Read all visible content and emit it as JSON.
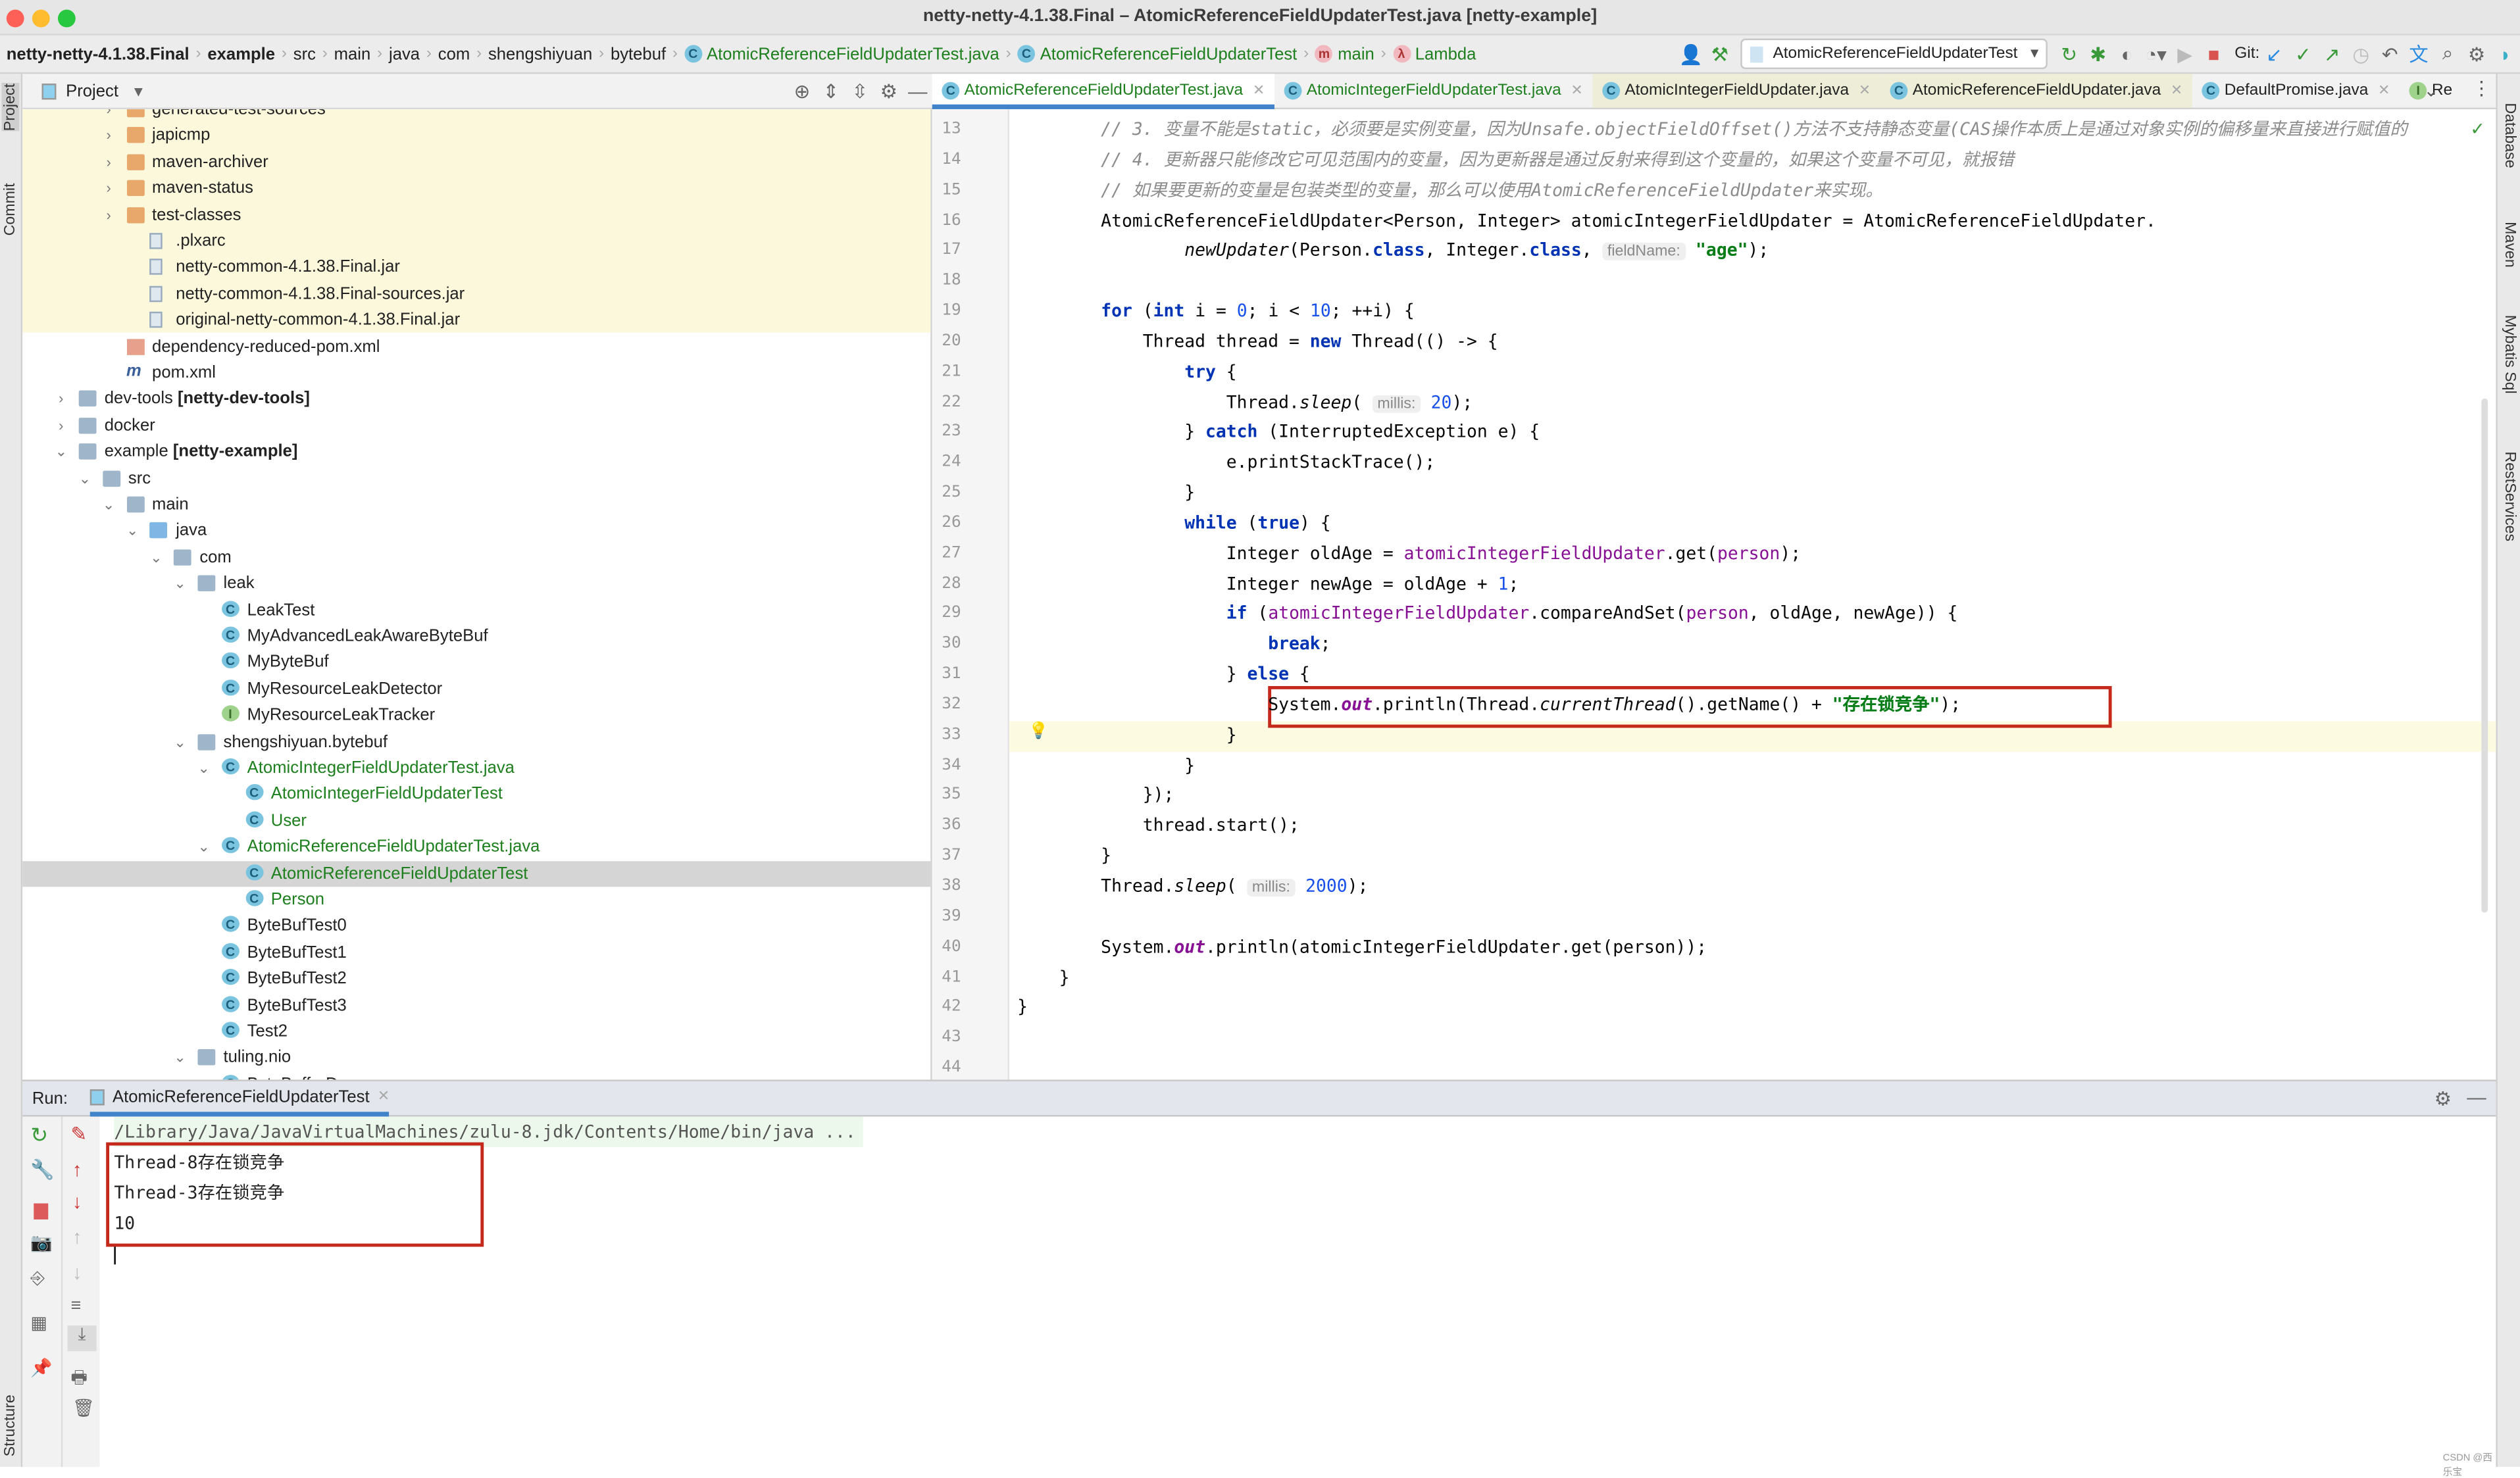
{
  "window": {
    "title": "netty-netty-4.1.38.Final – AtomicReferenceFieldUpdaterTest.java [netty-example]"
  },
  "breadcrumb": [
    "netty-netty-4.1.38.Final",
    "example",
    "src",
    "main",
    "java",
    "com",
    "shengshiyuan",
    "bytebuf",
    "AtomicReferenceFieldUpdaterTest.java",
    "AtomicReferenceFieldUpdaterTest",
    "main",
    "Lambda"
  ],
  "toolbar": {
    "run_config": "AtomicReferenceFieldUpdaterTest",
    "git_label": "Git:"
  },
  "left_strip": {
    "project": "Project",
    "commit": "Commit",
    "structure": "Structure"
  },
  "right_strip": [
    "Database",
    "Maven",
    "Mybatis Sql",
    "RestServices"
  ],
  "project": {
    "title": "Project",
    "tree": [
      {
        "level": 2,
        "type": "folder",
        "color": "orange",
        "name": "generated-test-sources",
        "arrow": ">"
      },
      {
        "level": 2,
        "type": "folder",
        "color": "orange",
        "name": "japicmp",
        "arrow": ">"
      },
      {
        "level": 2,
        "type": "folder",
        "color": "orange",
        "name": "maven-archiver",
        "arrow": ">"
      },
      {
        "level": 2,
        "type": "folder",
        "color": "orange",
        "name": "maven-status",
        "arrow": ">"
      },
      {
        "level": 2,
        "type": "folder",
        "color": "orange",
        "name": "test-classes",
        "arrow": ">"
      },
      {
        "level": 3,
        "type": "file",
        "name": ".plxarc"
      },
      {
        "level": 3,
        "type": "file",
        "name": "netty-common-4.1.38.Final.jar"
      },
      {
        "level": 3,
        "type": "file",
        "name": "netty-common-4.1.38.Final-sources.jar"
      },
      {
        "level": 3,
        "type": "file",
        "name": "original-netty-common-4.1.38.Final.jar"
      },
      {
        "level": 2,
        "type": "xml",
        "name": "dependency-reduced-pom.xml"
      },
      {
        "level": 2,
        "type": "maven",
        "name": "pom.xml"
      },
      {
        "level": 0,
        "type": "folder",
        "name": "dev-tools",
        "suffix": " [netty-dev-tools]",
        "arrow": ">"
      },
      {
        "level": 0,
        "type": "folder",
        "name": "docker",
        "arrow": ">"
      },
      {
        "level": 0,
        "type": "folder",
        "name": "example",
        "suffix": " [netty-example]",
        "arrow": "v"
      },
      {
        "level": 1,
        "type": "folder",
        "name": "src",
        "arrow": "v"
      },
      {
        "level": 2,
        "type": "folder",
        "name": "main",
        "arrow": "v"
      },
      {
        "level": 3,
        "type": "folder",
        "color": "blue",
        "name": "java",
        "arrow": "v"
      },
      {
        "level": 4,
        "type": "folder",
        "name": "com",
        "arrow": "v"
      },
      {
        "level": 5,
        "type": "folder",
        "name": "leak",
        "arrow": "v"
      },
      {
        "level": 6,
        "type": "class",
        "name": "LeakTest"
      },
      {
        "level": 6,
        "type": "class",
        "name": "MyAdvancedLeakAwareByteBuf"
      },
      {
        "level": 6,
        "type": "class",
        "name": "MyByteBuf"
      },
      {
        "level": 6,
        "type": "class",
        "name": "MyResourceLeakDetector"
      },
      {
        "level": 6,
        "type": "interface",
        "name": "MyResourceLeakTracker"
      },
      {
        "level": 5,
        "type": "folder",
        "name": "shengshiyuan.bytebuf",
        "arrow": "v"
      },
      {
        "level": 6,
        "type": "class",
        "name": "AtomicIntegerFieldUpdaterTest.java",
        "arrow": "v",
        "modified": true
      },
      {
        "level": 7,
        "type": "class",
        "name": "AtomicIntegerFieldUpdaterTest",
        "modified": true
      },
      {
        "level": 7,
        "type": "class",
        "name": "User",
        "modified": true
      },
      {
        "level": 6,
        "type": "class",
        "name": "AtomicReferenceFieldUpdaterTest.java",
        "arrow": "v",
        "modified": true
      },
      {
        "level": 7,
        "type": "class",
        "name": "AtomicReferenceFieldUpdaterTest",
        "modified": true,
        "selected": true
      },
      {
        "level": 7,
        "type": "class",
        "name": "Person",
        "modified": true
      },
      {
        "level": 6,
        "type": "class",
        "name": "ByteBufTest0"
      },
      {
        "level": 6,
        "type": "class",
        "name": "ByteBufTest1"
      },
      {
        "level": 6,
        "type": "class",
        "name": "ByteBufTest2"
      },
      {
        "level": 6,
        "type": "class",
        "name": "ByteBufTest3"
      },
      {
        "level": 6,
        "type": "class",
        "name": "Test2"
      },
      {
        "level": 5,
        "type": "folder",
        "name": "tuling.nio",
        "arrow": "v"
      },
      {
        "level": 6,
        "type": "class",
        "name": "ByteBufferDemo"
      }
    ]
  },
  "editor": {
    "tabs": [
      {
        "label": "AtomicReferenceFieldUpdaterTest.java",
        "active": true,
        "green": true
      },
      {
        "label": "AtomicIntegerFieldUpdaterTest.java",
        "green": true
      },
      {
        "label": "AtomicIntegerFieldUpdater.java",
        "mod": true
      },
      {
        "label": "AtomicReferenceFieldUpdater.java",
        "mod": true
      },
      {
        "label": "DefaultPromise.java"
      },
      {
        "label": "Re",
        "noclose": true
      }
    ],
    "first_line": 13,
    "current_line": 33,
    "lines": [
      [
        [
          "        // 3. 变量不能是static，必须要是实例变量，因为Unsafe.objectFieldOffset()方法不支持静态变量(CAS操作本质上是通过对象实例的偏移量来直接进行赋值的",
          "cm"
        ]
      ],
      [
        [
          "        // 4. 更新器只能修改它可见范围内的变量，因为更新器是通过反射来得到这个变量的，如果这个变量不可见，就报错",
          "cm"
        ]
      ],
      [
        [
          "        // 如果要更新的变量是包装类型的变量，那么可以使用AtomicReferenceFieldUpdater来实现。",
          "cm"
        ]
      ],
      [
        [
          "        AtomicReferenceFieldUpdater<Person, Integer> atomicIntegerFieldUpdater = AtomicReferenceFieldUpdater.",
          ""
        ]
      ],
      [
        [
          "                ",
          ""
        ],
        [
          "newUpdater",
          "sm"
        ],
        [
          "(Person.",
          ""
        ],
        [
          "class",
          "kw"
        ],
        [
          ", Integer.",
          ""
        ],
        [
          "class",
          "kw"
        ],
        [
          ", ",
          ""
        ],
        [
          "fieldName:",
          "ht"
        ],
        [
          " ",
          ""
        ],
        [
          "\"age\"",
          "st"
        ],
        [
          ");",
          ""
        ]
      ],
      [],
      [
        [
          "        ",
          ""
        ],
        [
          "for",
          "kw"
        ],
        [
          " (",
          ""
        ],
        [
          "int",
          "kw"
        ],
        [
          " i = ",
          ""
        ],
        [
          "0",
          "nm"
        ],
        [
          "; i < ",
          ""
        ],
        [
          "10",
          "nm"
        ],
        [
          "; ++i) {",
          ""
        ]
      ],
      [
        [
          "            Thread thread = ",
          ""
        ],
        [
          "new",
          "kw"
        ],
        [
          " Thread(() -> {",
          ""
        ]
      ],
      [
        [
          "                ",
          ""
        ],
        [
          "try",
          "kw"
        ],
        [
          " {",
          ""
        ]
      ],
      [
        [
          "                    Thread.",
          ""
        ],
        [
          "sleep",
          "sm"
        ],
        [
          "( ",
          ""
        ],
        [
          "millis:",
          "ht"
        ],
        [
          " ",
          ""
        ],
        [
          "20",
          "nm"
        ],
        [
          ");",
          ""
        ]
      ],
      [
        [
          "                } ",
          ""
        ],
        [
          "catch",
          "kw"
        ],
        [
          " (InterruptedException e) {",
          ""
        ]
      ],
      [
        [
          "                    e.printStackTrace();",
          ""
        ]
      ],
      [
        [
          "                }",
          ""
        ]
      ],
      [
        [
          "                ",
          ""
        ],
        [
          "while",
          "kw"
        ],
        [
          " (",
          ""
        ],
        [
          "true",
          "kw"
        ],
        [
          ") {",
          ""
        ]
      ],
      [
        [
          "                    Integer oldAge = ",
          ""
        ],
        [
          "atomicIntegerFieldUpdater",
          "fd"
        ],
        [
          ".get(",
          ""
        ],
        [
          "person",
          "fd"
        ],
        [
          ");",
          ""
        ]
      ],
      [
        [
          "                    Integer newAge = oldAge + ",
          ""
        ],
        [
          "1",
          "nm"
        ],
        [
          ";",
          ""
        ]
      ],
      [
        [
          "                    ",
          ""
        ],
        [
          "if",
          "kw"
        ],
        [
          " (",
          ""
        ],
        [
          "atomicIntegerFieldUpdater",
          "fd"
        ],
        [
          ".compareAndSet(",
          ""
        ],
        [
          "person",
          "fd"
        ],
        [
          ", oldAge, newAge)) {",
          ""
        ]
      ],
      [
        [
          "                        ",
          ""
        ],
        [
          "break",
          "kw"
        ],
        [
          ";",
          ""
        ]
      ],
      [
        [
          "                    } ",
          ""
        ],
        [
          "else",
          "kw"
        ],
        [
          " {",
          ""
        ]
      ],
      [
        [
          "                        System.",
          ""
        ],
        [
          "out",
          "so"
        ],
        [
          ".println(Thread.",
          ""
        ],
        [
          "currentThread",
          "sm"
        ],
        [
          "().getName() + ",
          ""
        ],
        [
          "\"存在锁竞争\"",
          "st"
        ],
        [
          ");",
          ""
        ]
      ],
      [
        [
          "                    }",
          ""
        ]
      ],
      [
        [
          "                }",
          ""
        ]
      ],
      [
        [
          "            });",
          ""
        ]
      ],
      [
        [
          "            thread.start();",
          ""
        ]
      ],
      [
        [
          "        }",
          ""
        ]
      ],
      [
        [
          "        Thread.",
          ""
        ],
        [
          "sleep",
          "sm"
        ],
        [
          "( ",
          ""
        ],
        [
          "millis:",
          "ht"
        ],
        [
          " ",
          ""
        ],
        [
          "2000",
          "nm"
        ],
        [
          ");",
          ""
        ]
      ],
      [],
      [
        [
          "        System.",
          ""
        ],
        [
          "out",
          "so"
        ],
        [
          ".println(atomicIntegerFieldUpdater.get(person));",
          ""
        ]
      ],
      [
        [
          "    }",
          ""
        ]
      ],
      [
        [
          "}",
          ""
        ]
      ],
      [],
      []
    ]
  },
  "run": {
    "label": "Run:",
    "tab": "AtomicReferenceFieldUpdaterTest",
    "command": "/Library/Java/JavaVirtualMachines/zulu-8.jdk/Contents/Home/bin/java ...",
    "output": [
      "Thread-8存在锁竞争",
      "Thread-3存在锁竞争",
      "10"
    ]
  },
  "watermark": "CSDN @西乐宝",
  "colors": {
    "highlight_box": "#c4291c",
    "accent": "#4083c9"
  }
}
